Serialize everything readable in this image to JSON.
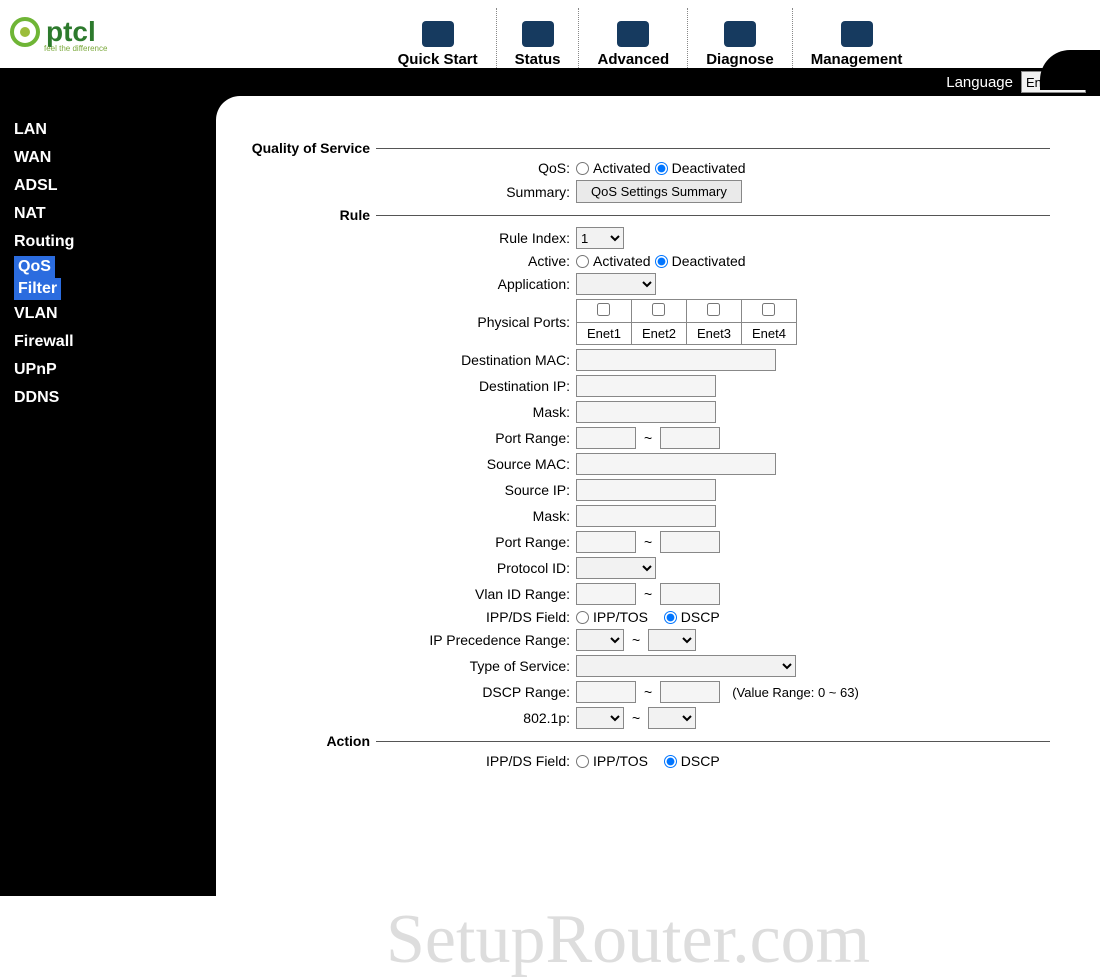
{
  "brand": {
    "name": "ptcl",
    "tagline": "feel the difference"
  },
  "nav": {
    "items": [
      {
        "label": "Quick Start",
        "icon": "quickstart-icon"
      },
      {
        "label": "Status",
        "icon": "status-icon"
      },
      {
        "label": "Advanced",
        "icon": "advanced-icon"
      },
      {
        "label": "Diagnose",
        "icon": "diagnose-icon"
      },
      {
        "label": "Management",
        "icon": "management-icon"
      }
    ]
  },
  "language": {
    "label": "Language",
    "selected": "English",
    "options": [
      "English"
    ]
  },
  "sidebar": {
    "items": [
      {
        "label": "LAN"
      },
      {
        "label": "WAN"
      },
      {
        "label": "ADSL"
      },
      {
        "label": "NAT"
      },
      {
        "label": "Routing"
      },
      {
        "label": "QoS",
        "selected": true
      },
      {
        "label": "Filter",
        "selected": true
      },
      {
        "label": "VLAN"
      },
      {
        "label": "Firewall"
      },
      {
        "label": "UPnP"
      },
      {
        "label": "DDNS"
      }
    ]
  },
  "sections": {
    "qos_title": "Quality of Service",
    "rule_title": "Rule",
    "action_title": "Action"
  },
  "form": {
    "qos_label": "QoS:",
    "qos_activated": "Activated",
    "qos_deactivated": "Deactivated",
    "qos_value": "Deactivated",
    "summary_label": "Summary:",
    "summary_button": "QoS Settings Summary",
    "rule_index_label": "Rule Index:",
    "rule_index_value": "1",
    "active_label": "Active:",
    "active_activated": "Activated",
    "active_deactivated": "Deactivated",
    "active_value": "Deactivated",
    "application_label": "Application:",
    "physical_ports_label": "Physical Ports:",
    "ports": [
      "Enet1",
      "Enet2",
      "Enet3",
      "Enet4"
    ],
    "dest_mac_label": "Destination MAC:",
    "dest_ip_label": "Destination IP:",
    "mask_label": "Mask:",
    "port_range_label": "Port Range:",
    "src_mac_label": "Source MAC:",
    "src_ip_label": "Source IP:",
    "mask2_label": "Mask:",
    "port_range2_label": "Port Range:",
    "protocol_label": "Protocol ID:",
    "vlan_range_label": "Vlan ID Range:",
    "ipp_ds_label": "IPP/DS Field:",
    "ipp_tos": "IPP/TOS",
    "dscp": "DSCP",
    "ipp_ds_value": "DSCP",
    "ip_prec_label": "IP Precedence Range:",
    "tos_label": "Type of Service:",
    "dscp_range_label": "DSCP Range:",
    "dscp_note": "(Value Range: 0 ~ 63)",
    "p8021_label": "802.1p:",
    "action_ipp_ds_label": "IPP/DS Field:",
    "action_ipp_tos": "IPP/TOS",
    "action_dscp": "DSCP",
    "action_ipp_ds_value": "DSCP"
  },
  "watermark": "SetupRouter.com"
}
